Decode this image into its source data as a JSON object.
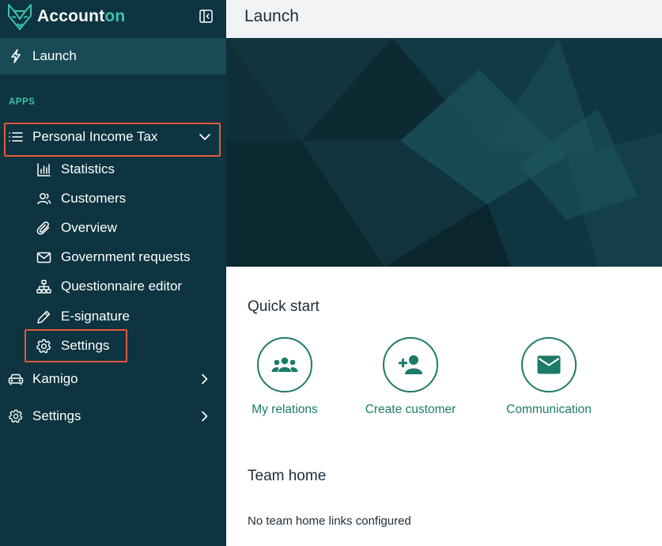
{
  "brand": {
    "name_part1": "Account",
    "name_part2": "on",
    "accent_color": "#3cc3a8"
  },
  "sidebar": {
    "launch_label": "Launch",
    "apps_heading": "APPS",
    "app_personal_income_tax": {
      "label": "Personal Income Tax",
      "expanded": true,
      "items": [
        {
          "label": "Statistics",
          "icon": "bar-chart-icon"
        },
        {
          "label": "Customers",
          "icon": "users-icon"
        },
        {
          "label": "Overview",
          "icon": "paperclip-icon"
        },
        {
          "label": "Government requests",
          "icon": "mail-icon"
        },
        {
          "label": "Questionnaire editor",
          "icon": "sitemap-icon"
        },
        {
          "label": "E-signature",
          "icon": "pen-icon"
        },
        {
          "label": "Settings",
          "icon": "gear-icon"
        }
      ]
    },
    "kamigo_label": "Kamigo",
    "settings_label": "Settings"
  },
  "main": {
    "title": "Launch",
    "quick_start": {
      "heading": "Quick start",
      "items": [
        {
          "label": "My relations",
          "icon": "group-icon"
        },
        {
          "label": "Create customer",
          "icon": "add-user-icon"
        },
        {
          "label": "Communication",
          "icon": "envelope-icon"
        }
      ]
    },
    "team_home": {
      "heading": "Team home",
      "empty_text": "No team home links configured"
    }
  },
  "colors": {
    "sidebar_bg": "#0d3440",
    "active_row_bg": "#184b55",
    "highlight_border": "#e25a3a",
    "primary_green": "#1e7a69"
  }
}
